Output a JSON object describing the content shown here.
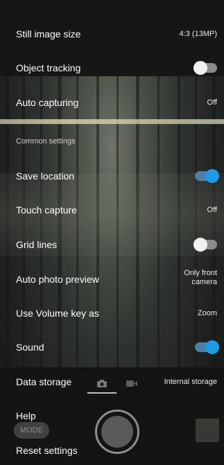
{
  "settings": {
    "still_image_size": {
      "label": "Still image size",
      "value": "4:3 (13MP)"
    },
    "object_tracking": {
      "label": "Object tracking",
      "state": "off"
    },
    "auto_capturing": {
      "label": "Auto capturing",
      "value": "Off"
    },
    "common_settings_header": "Common settings",
    "save_location": {
      "label": "Save location",
      "state": "on"
    },
    "touch_capture": {
      "label": "Touch capture",
      "value": "Off"
    },
    "grid_lines": {
      "label": "Grid lines",
      "state": "off"
    },
    "auto_photo_preview": {
      "label": "Auto photo preview",
      "value_line1": "Only front",
      "value_line2": "camera"
    },
    "use_volume_key_as": {
      "label": "Use Volume key as",
      "value": "Zoom"
    },
    "sound": {
      "label": "Sound",
      "state": "on"
    },
    "data_storage": {
      "label": "Data storage",
      "value": "Internal storage"
    },
    "help": {
      "label": "Help"
    },
    "reset_settings": {
      "label": "Reset settings"
    }
  },
  "camera_controls": {
    "mode_button_label": "MODE",
    "selected_mode": "photo",
    "modes": [
      {
        "name": "photo",
        "icon": "camera-icon"
      },
      {
        "name": "video",
        "icon": "video-icon"
      }
    ]
  },
  "colors": {
    "toggle_on": "#1e9be4",
    "toggle_off": "#8b8b8b"
  }
}
